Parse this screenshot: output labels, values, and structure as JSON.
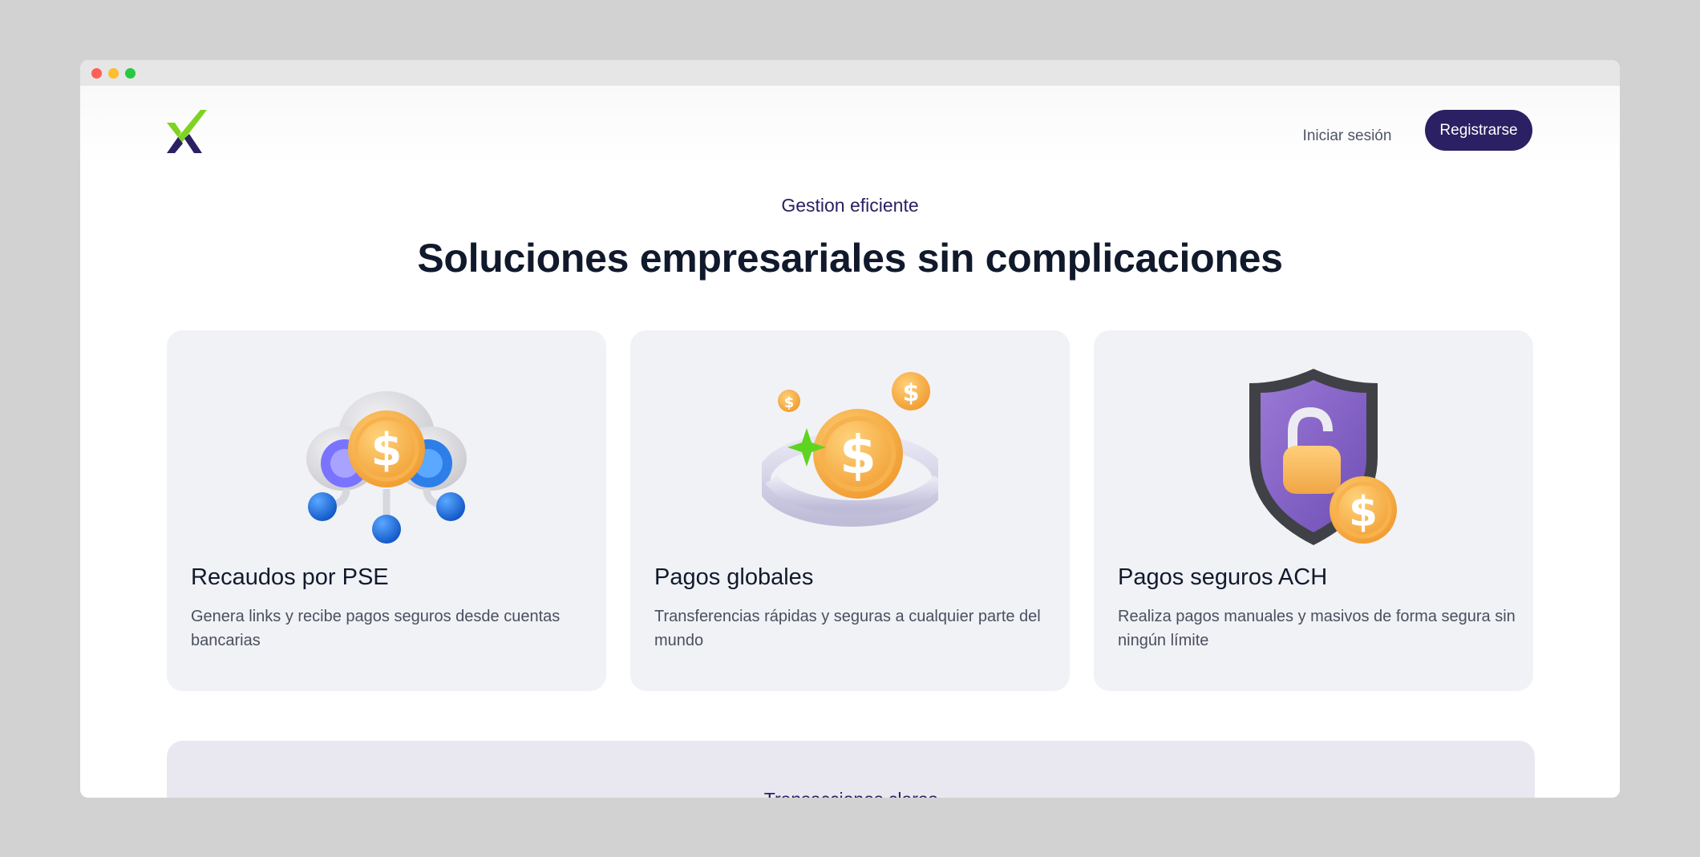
{
  "nav": {
    "login_label": "Iniciar sesión",
    "register_label": "Registrarse"
  },
  "hero": {
    "eyebrow": "Gestion eficiente",
    "headline": "Soluciones empresariales sin complicaciones"
  },
  "cards": [
    {
      "icon": "cloud-coin-icon",
      "title": "Recaudos por PSE",
      "description": "Genera links y recibe pagos seguros desde cuentas bancarias"
    },
    {
      "icon": "orbit-coins-icon",
      "title": "Pagos globales",
      "description": "Transferencias rápidas y seguras a cualquier parte del mundo"
    },
    {
      "icon": "shield-lock-coin-icon",
      "title": "Pagos seguros ACH",
      "description": "Realiza pagos manuales y masivos de forma segura sin ningún límite"
    }
  ],
  "band": {
    "label": "Transacciones claras"
  },
  "colors": {
    "brand_primary": "#2b2063",
    "brand_green": "#7ed321",
    "card_bg": "#f1f2f6",
    "band_bg": "#e9e8f1"
  }
}
